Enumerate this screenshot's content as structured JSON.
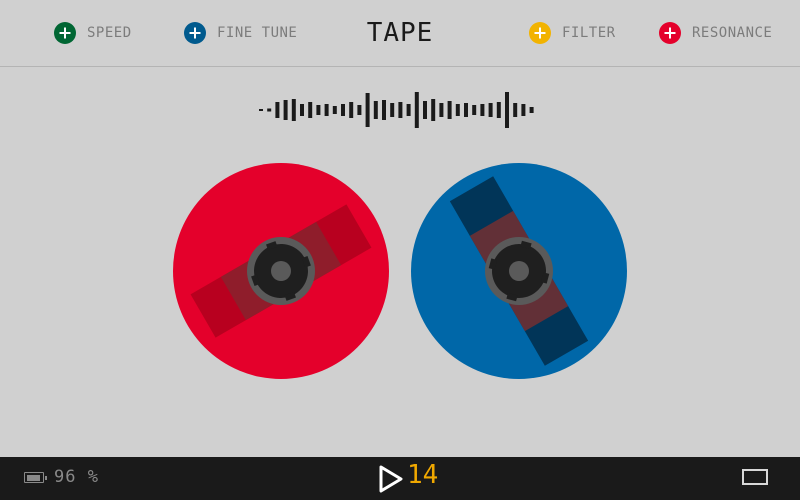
{
  "header": {
    "title": "TAPE",
    "params": [
      {
        "label": "SPEED",
        "color": "#006633"
      },
      {
        "label": "FINE TUNE",
        "color": "#005a8e"
      },
      {
        "label": "FILTER",
        "color": "#f2b300"
      },
      {
        "label": "RESONANCE",
        "color": "#e4002b"
      }
    ]
  },
  "reels": {
    "left_color": "#e4002b",
    "left_tape_color": "#b8001f",
    "right_color": "#0067a8",
    "right_tape_color": "#013558",
    "hub_color": "#1f1f1f",
    "hub_ring_color": "#5a5a5a"
  },
  "footer": {
    "battery": "96 %",
    "step_count": "14",
    "accent_color": "#f0a800"
  },
  "icons": {
    "play": "play-icon",
    "battery": "battery-icon",
    "window": "window-icon"
  }
}
